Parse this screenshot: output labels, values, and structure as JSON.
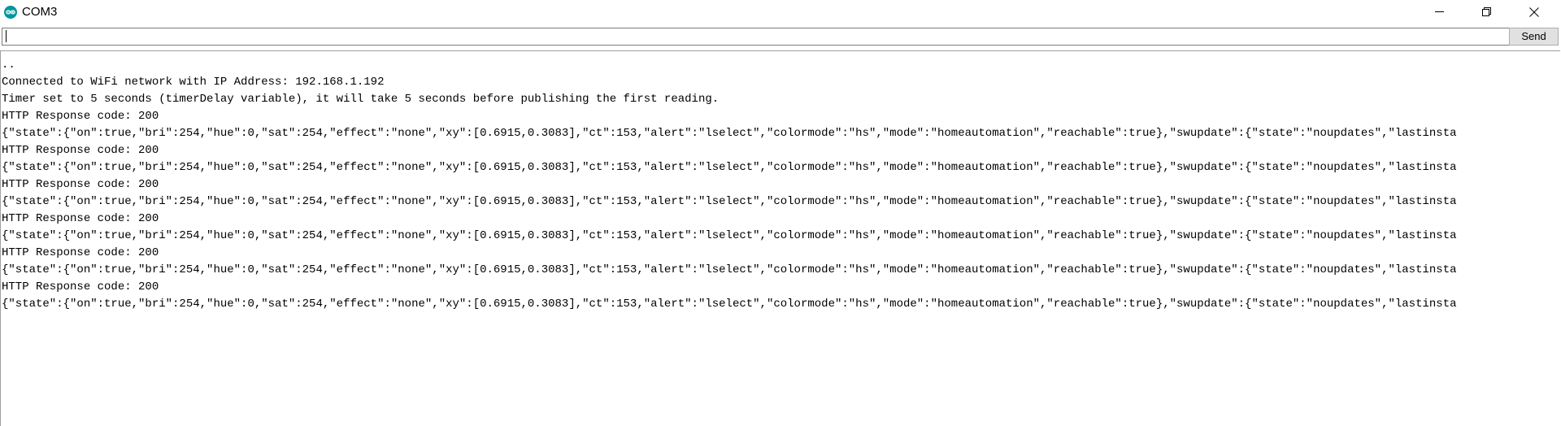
{
  "window": {
    "title": "COM3",
    "icon": "arduino-icon",
    "controls": {
      "minimize_icon": "minimize-icon",
      "maximize_icon": "restore-icon",
      "close_icon": "close-icon"
    }
  },
  "input": {
    "value": "",
    "send_label": "Send"
  },
  "output": {
    "lines": [
      "..",
      "Connected to WiFi network with IP Address: 192.168.1.192",
      "Timer set to 5 seconds (timerDelay variable), it will take 5 seconds before publishing the first reading.",
      "HTTP Response code: 200",
      "{\"state\":{\"on\":true,\"bri\":254,\"hue\":0,\"sat\":254,\"effect\":\"none\",\"xy\":[0.6915,0.3083],\"ct\":153,\"alert\":\"lselect\",\"colormode\":\"hs\",\"mode\":\"homeautomation\",\"reachable\":true},\"swupdate\":{\"state\":\"noupdates\",\"lastinsta",
      "HTTP Response code: 200",
      "{\"state\":{\"on\":true,\"bri\":254,\"hue\":0,\"sat\":254,\"effect\":\"none\",\"xy\":[0.6915,0.3083],\"ct\":153,\"alert\":\"lselect\",\"colormode\":\"hs\",\"mode\":\"homeautomation\",\"reachable\":true},\"swupdate\":{\"state\":\"noupdates\",\"lastinsta",
      "HTTP Response code: 200",
      "{\"state\":{\"on\":true,\"bri\":254,\"hue\":0,\"sat\":254,\"effect\":\"none\",\"xy\":[0.6915,0.3083],\"ct\":153,\"alert\":\"lselect\",\"colormode\":\"hs\",\"mode\":\"homeautomation\",\"reachable\":true},\"swupdate\":{\"state\":\"noupdates\",\"lastinsta",
      "HTTP Response code: 200",
      "{\"state\":{\"on\":true,\"bri\":254,\"hue\":0,\"sat\":254,\"effect\":\"none\",\"xy\":[0.6915,0.3083],\"ct\":153,\"alert\":\"lselect\",\"colormode\":\"hs\",\"mode\":\"homeautomation\",\"reachable\":true},\"swupdate\":{\"state\":\"noupdates\",\"lastinsta",
      "HTTP Response code: 200",
      "{\"state\":{\"on\":true,\"bri\":254,\"hue\":0,\"sat\":254,\"effect\":\"none\",\"xy\":[0.6915,0.3083],\"ct\":153,\"alert\":\"lselect\",\"colormode\":\"hs\",\"mode\":\"homeautomation\",\"reachable\":true},\"swupdate\":{\"state\":\"noupdates\",\"lastinsta",
      "HTTP Response code: 200",
      "{\"state\":{\"on\":true,\"bri\":254,\"hue\":0,\"sat\":254,\"effect\":\"none\",\"xy\":[0.6915,0.3083],\"ct\":153,\"alert\":\"lselect\",\"colormode\":\"hs\",\"mode\":\"homeautomation\",\"reachable\":true},\"swupdate\":{\"state\":\"noupdates\",\"lastinsta"
    ]
  },
  "colors": {
    "icon_teal": "#00979c",
    "button_face": "#e1e1e1",
    "border": "#7a7a7a"
  }
}
